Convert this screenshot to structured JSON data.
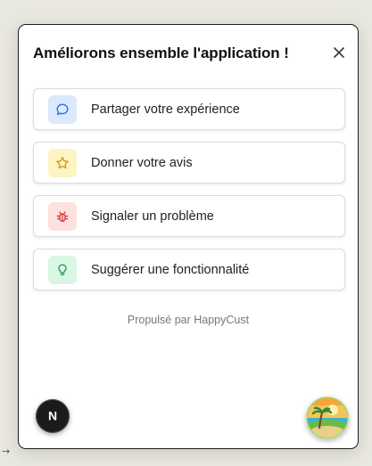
{
  "backdrop": {
    "arrow_glyph": "→"
  },
  "modal": {
    "title": "Améliorons ensemble l'application !",
    "close_icon": "close-icon",
    "options": [
      {
        "label": "Partager votre expérience",
        "icon": "chat-bubble-icon",
        "icon_bg": "#dbe8fd",
        "icon_color": "#2f6fe4"
      },
      {
        "label": "Donner votre avis",
        "icon": "star-icon",
        "icon_bg": "#fdf4c4",
        "icon_color": "#c99a06"
      },
      {
        "label": "Signaler un problème",
        "icon": "bug-icon",
        "icon_bg": "#fde0e0",
        "icon_color": "#d62f2f"
      },
      {
        "label": "Suggérer une fonctionnalité",
        "icon": "lightbulb-icon",
        "icon_bg": "#daf6e4",
        "icon_color": "#1e9a4f"
      }
    ],
    "powered_by": "Propulsé par HappyCust"
  },
  "floating": {
    "next_badge_letter": "N",
    "avatar_icon": "island-avatar-icon"
  }
}
